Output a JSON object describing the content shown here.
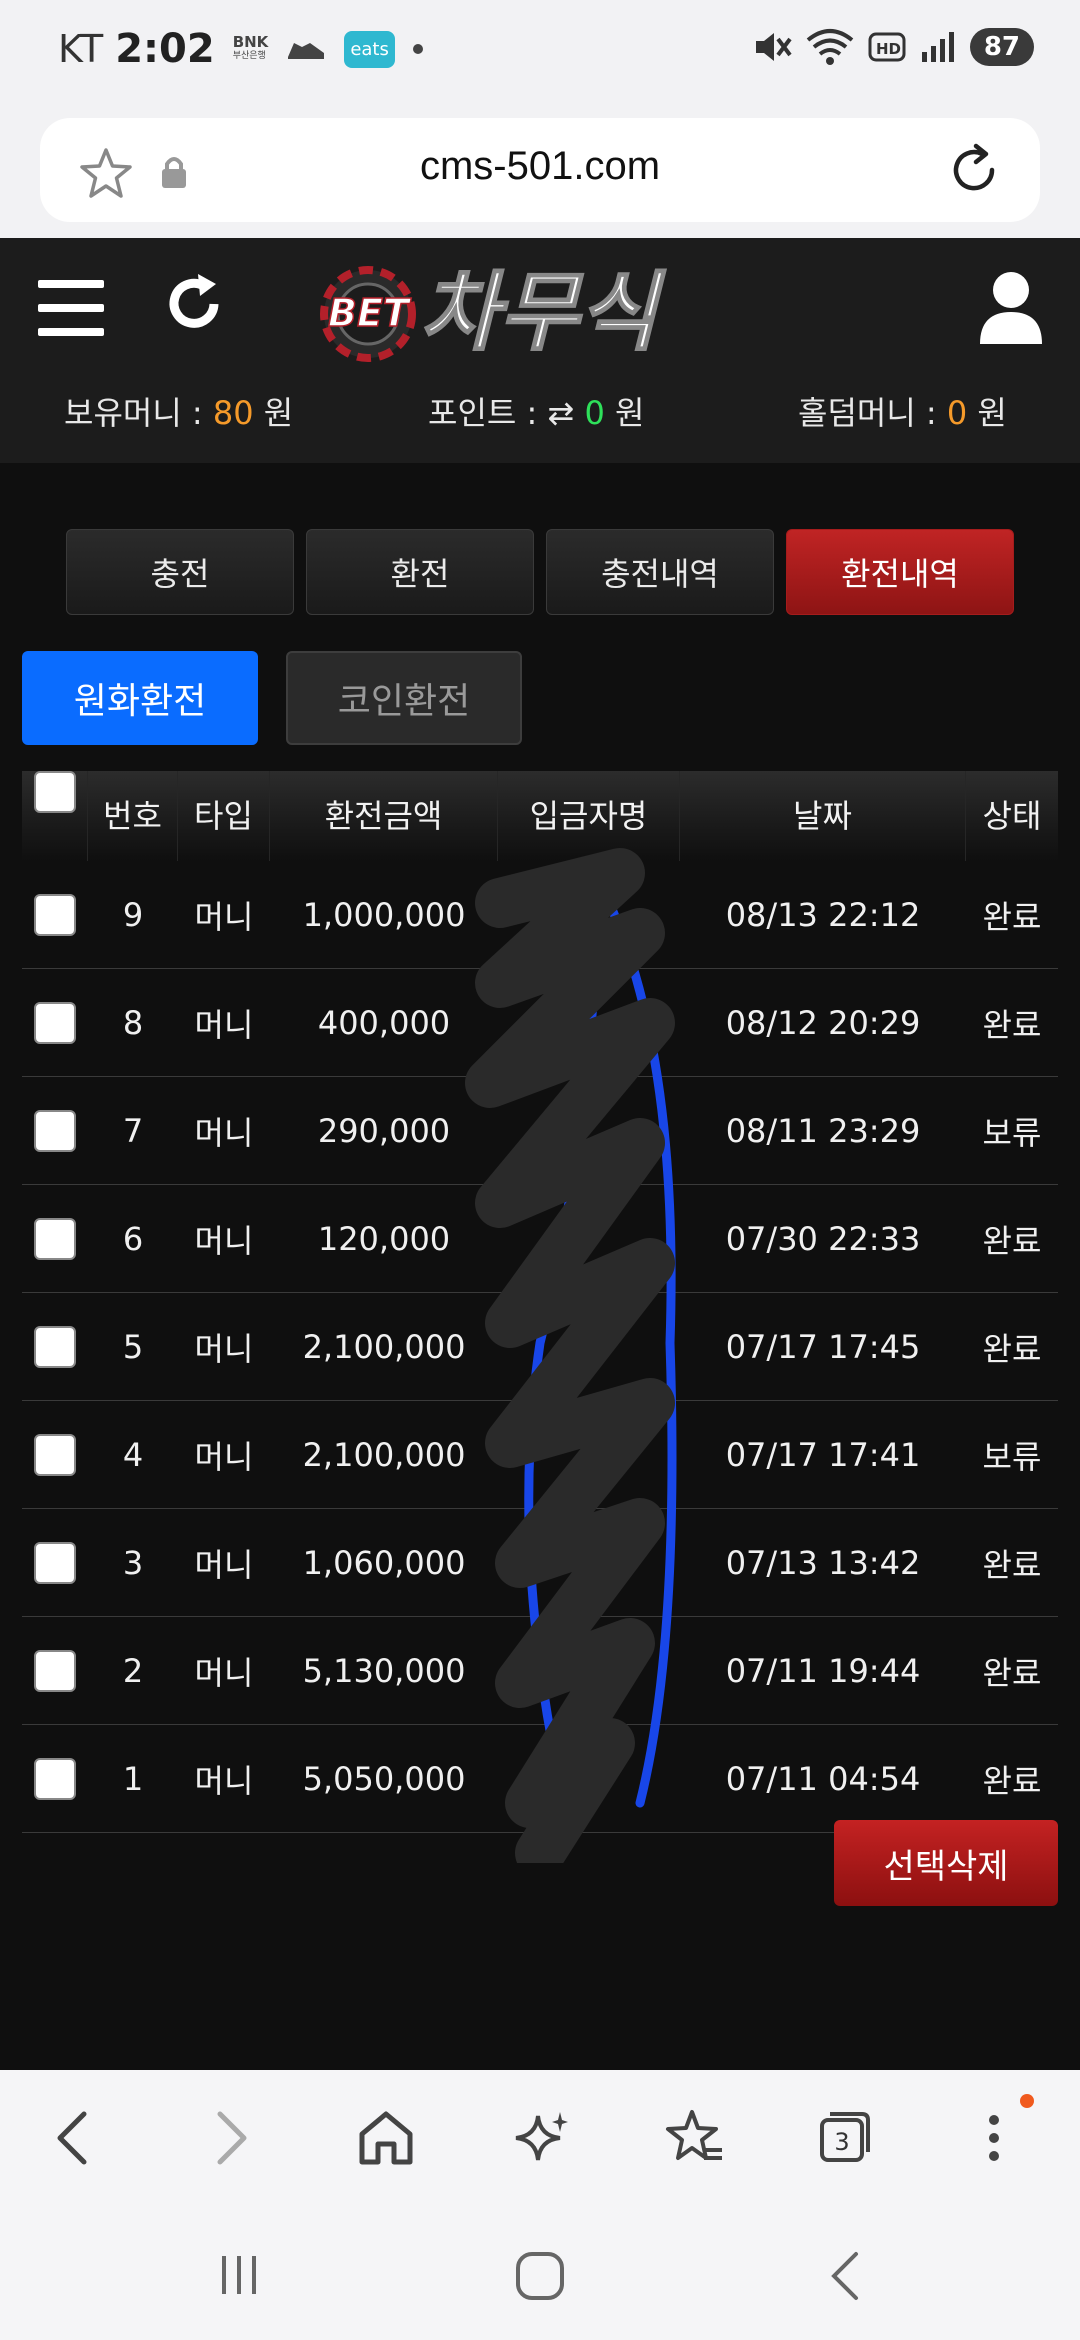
{
  "status_bar": {
    "carrier": "KT",
    "time": "2:02",
    "bank_label": "BNK",
    "bank_sub": "부산은행",
    "eats_label": "eats",
    "battery": "87"
  },
  "browser": {
    "url": "cms-501.com",
    "tab_count": "3"
  },
  "site": {
    "logo_prefix": "BET",
    "logo_text": "차무식",
    "balances": [
      {
        "label": "보유머니 : ",
        "value": "80",
        "unit": " 원"
      },
      {
        "label": "포인트 : ",
        "icon": "⇄",
        "value": "0",
        "unit": " 원"
      },
      {
        "label": "홀덤머니 : ",
        "value": "0",
        "unit": " 원"
      }
    ]
  },
  "tabs": [
    "충전",
    "환전",
    "충전내역",
    "환전내역"
  ],
  "subtabs": [
    "원화환전",
    "코인환전"
  ],
  "table": {
    "headers": [
      "번호",
      "타입",
      "환전금액",
      "입금자명",
      "날짜",
      "상태"
    ],
    "rows": [
      {
        "no": "9",
        "type": "머니",
        "amount": "1,000,000",
        "name": "",
        "date": "08/13 22:12",
        "status": "완료"
      },
      {
        "no": "8",
        "type": "머니",
        "amount": "400,000",
        "name": "",
        "date": "08/12 20:29",
        "status": "완료"
      },
      {
        "no": "7",
        "type": "머니",
        "amount": "290,000",
        "name": "",
        "date": "08/11 23:29",
        "status": "보류"
      },
      {
        "no": "6",
        "type": "머니",
        "amount": "120,000",
        "name": "",
        "date": "07/30 22:33",
        "status": "완료"
      },
      {
        "no": "5",
        "type": "머니",
        "amount": "2,100,000",
        "name": "",
        "date": "07/17 17:45",
        "status": "완료"
      },
      {
        "no": "4",
        "type": "머니",
        "amount": "2,100,000",
        "name": "",
        "date": "07/17 17:41",
        "status": "보류"
      },
      {
        "no": "3",
        "type": "머니",
        "amount": "1,060,000",
        "name": "",
        "date": "07/13 13:42",
        "status": "완료"
      },
      {
        "no": "2",
        "type": "머니",
        "amount": "5,130,000",
        "name": "",
        "date": "07/11 19:44",
        "status": "완료"
      },
      {
        "no": "1",
        "type": "머니",
        "amount": "5,050,000",
        "name": "",
        "date": "07/11 04:54",
        "status": "완료"
      }
    ]
  },
  "delete_button": "선택삭제",
  "colors": {
    "accent_red": "#b01c1c",
    "accent_blue": "#0a6cff",
    "balance_orange": "#f59a2a",
    "point_green": "#2ee05a"
  }
}
